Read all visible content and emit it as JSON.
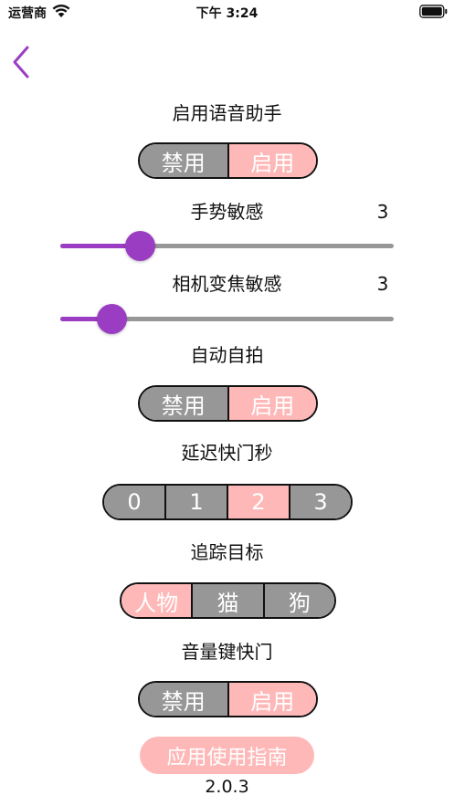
{
  "status_bar": {
    "carrier": "运营商",
    "time": "下午 3:24"
  },
  "colors": {
    "accent": "#9a3dc2",
    "selected": "#ffb8b8",
    "unselected": "#979797"
  },
  "voice_assistant": {
    "label": "启用语音助手",
    "options": [
      "禁用",
      "启用"
    ],
    "selected": "启用"
  },
  "gesture_sensitivity": {
    "label": "手势敏感",
    "value": "3",
    "level": 0.24
  },
  "camera_zoom_sensitivity": {
    "label": "相机变焦敏感",
    "value": "3",
    "level": 0.155
  },
  "auto_selfie": {
    "label": "自动自拍",
    "options": [
      "禁用",
      "启用"
    ],
    "selected": "启用"
  },
  "shutter_delay": {
    "label": "延迟快门秒",
    "options": [
      "0",
      "1",
      "2",
      "3"
    ],
    "selected": "2"
  },
  "tracking_target": {
    "label": "追踪目标",
    "options": [
      "人物",
      "猫",
      "狗"
    ],
    "selected": "人物"
  },
  "volume_key_shutter": {
    "label": "音量键快门",
    "options": [
      "禁用",
      "启用"
    ],
    "selected": "启用"
  },
  "guide_button": "应用使用指南",
  "version": "2.0.3"
}
